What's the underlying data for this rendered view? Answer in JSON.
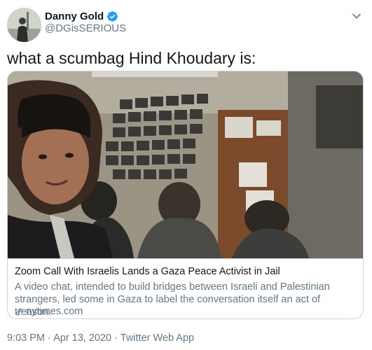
{
  "tweet": {
    "author": {
      "display_name": "Danny Gold",
      "handle": "@DGisSERIOUS",
      "verified": true,
      "verified_color": "#1da1f2"
    },
    "text": "what a scumbag Hind Khoudary is:",
    "card": {
      "title": "Zoom Call With Israelis Lands a Gaza Peace Activist in Jail",
      "description": "A video chat, intended to build bridges between Israeli and Palestinian strangers, led some in Gaza to label the conversation itself an act of treason.",
      "domain": "nytimes.com",
      "domain_icon": "link-icon",
      "image_icon": "video-still"
    },
    "timestamp": "9:03 PM · Apr 13, 2020",
    "separator": "·",
    "source": "Twitter Web App",
    "menu_icon": "chevron-down-icon"
  },
  "colors": {
    "text_primary": "#14171a",
    "text_secondary": "#657786",
    "border": "#ccd6dd",
    "brand_blue": "#1da1f2"
  }
}
